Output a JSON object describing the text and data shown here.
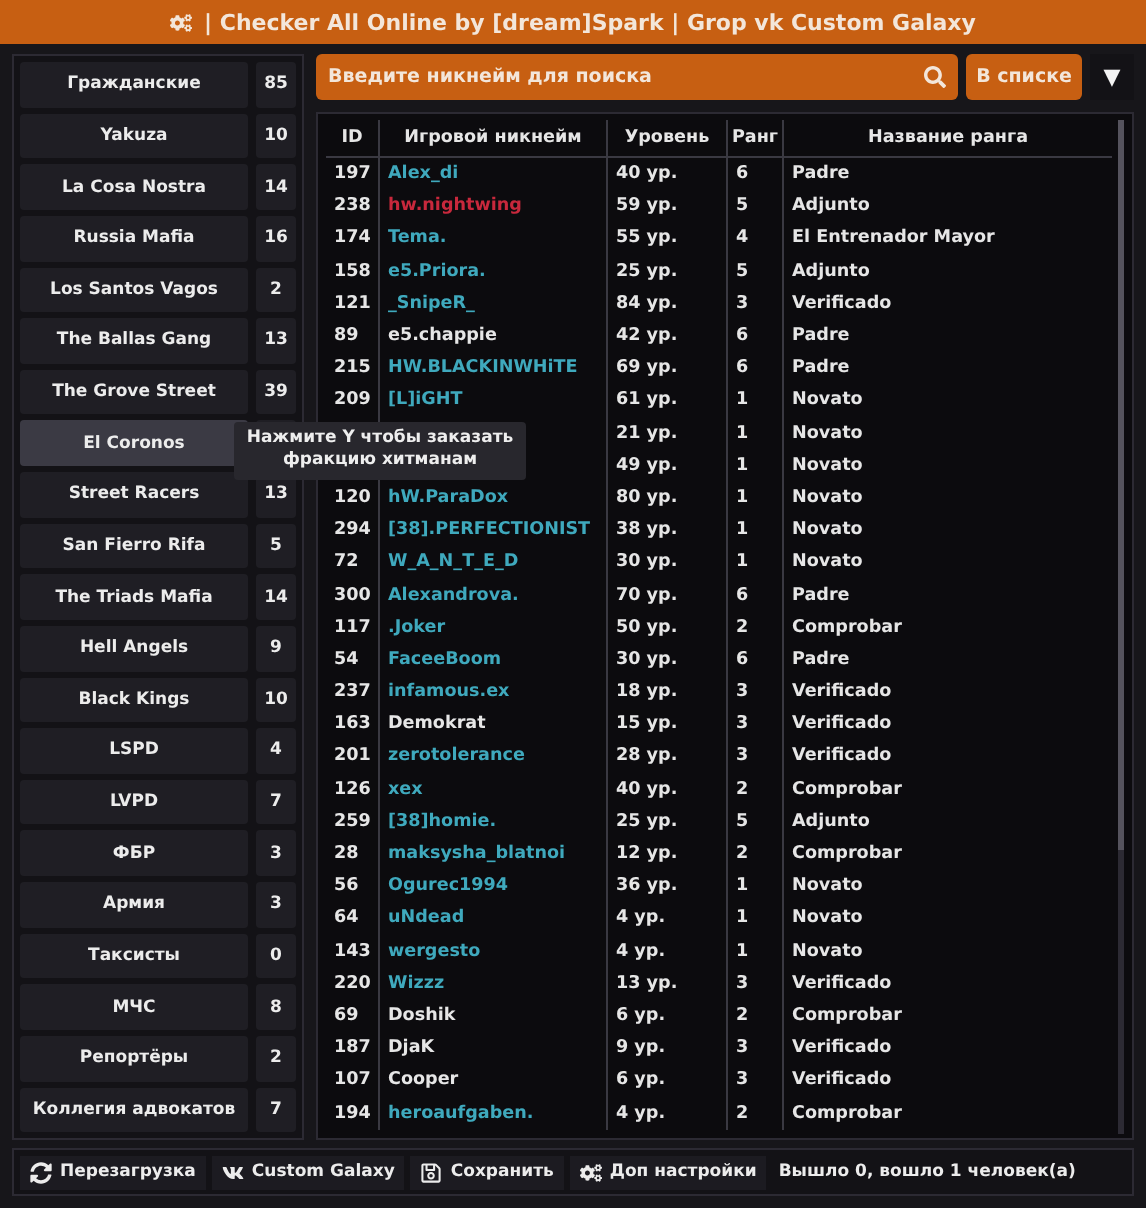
{
  "window": {
    "title": "| Checker All Online by [dream]Spark | Grop vk Custom Galaxy"
  },
  "sidebar": {
    "items": [
      {
        "label": "Гражданские",
        "count": "85",
        "selected": false
      },
      {
        "label": "Yakuza",
        "count": "10",
        "selected": false
      },
      {
        "label": "La Cosa Nostra",
        "count": "14",
        "selected": false
      },
      {
        "label": "Russia Mafia",
        "count": "16",
        "selected": false
      },
      {
        "label": "Los Santos Vagos",
        "count": "2",
        "selected": false
      },
      {
        "label": "The Ballas Gang",
        "count": "13",
        "selected": false
      },
      {
        "label": "The Grove Street",
        "count": "39",
        "selected": false
      },
      {
        "label": "El Coronos",
        "selected": true
      },
      {
        "label": "Street Racers",
        "count": "13",
        "selected": false
      },
      {
        "label": "San Fierro Rifa",
        "count": "5",
        "selected": false
      },
      {
        "label": "The Triads Mafia",
        "count": "14",
        "selected": false
      },
      {
        "label": "Hell Angels",
        "count": "9",
        "selected": false
      },
      {
        "label": "Black Kings",
        "count": "10",
        "selected": false
      },
      {
        "label": "LSPD",
        "count": "4",
        "selected": false
      },
      {
        "label": "LVPD",
        "count": "7",
        "selected": false
      },
      {
        "label": "ФБР",
        "count": "3",
        "selected": false
      },
      {
        "label": "Армия",
        "count": "3",
        "selected": false
      },
      {
        "label": "Таксисты",
        "count": "0",
        "selected": false
      },
      {
        "label": "МЧС",
        "count": "8",
        "selected": false
      },
      {
        "label": "Репортёры",
        "count": "2",
        "selected": false
      },
      {
        "label": "Коллегия адвокатов",
        "count": "7",
        "selected": false
      }
    ]
  },
  "tooltip": {
    "text": "Нажмите Y чтобы заказать фракцию хитманам"
  },
  "search": {
    "placeholder": "Введите никнейм для поиска"
  },
  "filter": {
    "label": "В списке",
    "arrow": "▼"
  },
  "table": {
    "columns": [
      "ID",
      "Игровой никнейм",
      "Уровень",
      "Ранг",
      "Название ранга"
    ],
    "rows": [
      {
        "id": "197",
        "nickname": "Alex_di",
        "color": "#3fa9bd",
        "level": "40 ур.",
        "rank": "6",
        "rank_name": "Padre"
      },
      {
        "id": "238",
        "nickname": "hw.nightwing",
        "color": "#c8283c",
        "level": "59 ур.",
        "rank": "5",
        "rank_name": "Adjunto"
      },
      {
        "id": "174",
        "nickname": "Tema.",
        "color": "#3fa9bd",
        "level": "55 ур.",
        "rank": "4",
        "rank_name": "El Entrenador Mayor"
      },
      {
        "id": "158",
        "nickname": "e5.Priora.",
        "color": "#3fa9bd",
        "level": "25 ур.",
        "rank": "5",
        "rank_name": "Adjunto"
      },
      {
        "id": "121",
        "nickname": "_SnipeR_",
        "color": "#3fa9bd",
        "level": "84 ур.",
        "rank": "3",
        "rank_name": "Verificado"
      },
      {
        "id": "89",
        "nickname": "e5.chappie",
        "color": "#e6e6e6",
        "level": "42 ур.",
        "rank": "6",
        "rank_name": "Padre"
      },
      {
        "id": "215",
        "nickname": "HW.BLACKINWHiTE",
        "color": "#3fa9bd",
        "level": "69 ур.",
        "rank": "6",
        "rank_name": "Padre"
      },
      {
        "id": "209",
        "nickname": "[L]iGHT",
        "color": "#3fa9bd",
        "level": "61 ур.",
        "rank": "1",
        "rank_name": "Novato"
      },
      {
        "level": "21 ур.",
        "rank": "1",
        "rank_name": "Novato"
      },
      {
        "level": "49 ур.",
        "rank": "1",
        "rank_name": "Novato"
      },
      {
        "id": "120",
        "nickname": "hW.ParaDox",
        "color": "#3fa9bd",
        "level": "80 ур.",
        "rank": "1",
        "rank_name": "Novato"
      },
      {
        "id": "294",
        "nickname": "[38].PERFECTIONIST",
        "color": "#3fa9bd",
        "level": "38 ур.",
        "rank": "1",
        "rank_name": "Novato"
      },
      {
        "id": "72",
        "nickname": "W_A_N_T_E_D",
        "color": "#3fa9bd",
        "level": "30 ур.",
        "rank": "1",
        "rank_name": "Novato"
      },
      {
        "id": "300",
        "nickname": "Alexandrova.",
        "color": "#3fa9bd",
        "level": "70 ур.",
        "rank": "6",
        "rank_name": "Padre"
      },
      {
        "id": "117",
        "nickname": ".Joker",
        "color": "#3fa9bd",
        "level": "50 ур.",
        "rank": "2",
        "rank_name": "Comprobar"
      },
      {
        "id": "54",
        "nickname": "FaceeBoom",
        "color": "#3fa9bd",
        "level": "30 ур.",
        "rank": "6",
        "rank_name": "Padre"
      },
      {
        "id": "237",
        "nickname": "infamous.ex",
        "color": "#3fa9bd",
        "level": "18 ур.",
        "rank": "3",
        "rank_name": "Verificado"
      },
      {
        "id": "163",
        "nickname": "Demokrat",
        "color": "#e6e6e6",
        "level": "15 ур.",
        "rank": "3",
        "rank_name": "Verificado"
      },
      {
        "id": "201",
        "nickname": "zerotolerance",
        "color": "#3fa9bd",
        "level": "28 ур.",
        "rank": "3",
        "rank_name": "Verificado"
      },
      {
        "id": "126",
        "nickname": "xex",
        "color": "#3fa9bd",
        "level": "40 ур.",
        "rank": "2",
        "rank_name": "Comprobar"
      },
      {
        "id": "259",
        "nickname": "[38]homie.",
        "color": "#3fa9bd",
        "level": "25 ур.",
        "rank": "5",
        "rank_name": "Adjunto"
      },
      {
        "id": "28",
        "nickname": "maksysha_blatnoi",
        "color": "#3fa9bd",
        "level": "12 ур.",
        "rank": "2",
        "rank_name": "Comprobar"
      },
      {
        "id": "56",
        "nickname": "Ogurec1994",
        "color": "#3fa9bd",
        "level": "36 ур.",
        "rank": "1",
        "rank_name": "Novato"
      },
      {
        "id": "64",
        "nickname": "uNdead",
        "color": "#3fa9bd",
        "level": "4 ур.",
        "rank": "1",
        "rank_name": "Novato"
      },
      {
        "id": "143",
        "nickname": "wergesto",
        "color": "#3fa9bd",
        "level": "4 ур.",
        "rank": "1",
        "rank_name": "Novato"
      },
      {
        "id": "220",
        "nickname": "Wizzz",
        "color": "#3fa9bd",
        "level": "13 ур.",
        "rank": "3",
        "rank_name": "Verificado"
      },
      {
        "id": "69",
        "nickname": "Doshik",
        "color": "#e6e6e6",
        "level": "6 ур.",
        "rank": "2",
        "rank_name": "Comprobar"
      },
      {
        "id": "187",
        "nickname": "DjaK",
        "color": "#e6e6e6",
        "level": "9 ур.",
        "rank": "3",
        "rank_name": "Verificado"
      },
      {
        "id": "107",
        "nickname": "Cooper",
        "color": "#e6e6e6",
        "level": "6 ур.",
        "rank": "3",
        "rank_name": "Verificado"
      },
      {
        "id": "194",
        "nickname": "heroaufgaben.",
        "color": "#3fa9bd",
        "level": "4 ур.",
        "rank": "2",
        "rank_name": "Comprobar"
      }
    ]
  },
  "footer": {
    "buttons": [
      {
        "kind": "reload",
        "label": "Перезагрузка"
      },
      {
        "kind": "vk",
        "label": "Custom Galaxy"
      },
      {
        "kind": "save",
        "label": "Сохранить"
      },
      {
        "kind": "settings",
        "label": "Доп настройки"
      }
    ],
    "status": "Вышло 0, вошло 1 человек(а)"
  }
}
